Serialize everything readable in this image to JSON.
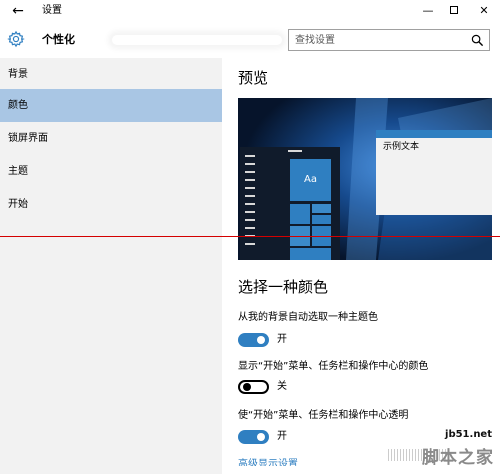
{
  "window": {
    "title": "设置",
    "back_icon": "back-arrow-icon",
    "minimize_glyph": "—",
    "close_glyph": "✕"
  },
  "header": {
    "title": "个性化",
    "icon": "gear-icon"
  },
  "search": {
    "placeholder": "查找设置",
    "icon": "search-icon"
  },
  "sidebar": {
    "items": [
      {
        "label": "背景"
      },
      {
        "label": "颜色",
        "selected": true
      },
      {
        "label": "锁屏界面"
      },
      {
        "label": "主题"
      },
      {
        "label": "开始"
      }
    ]
  },
  "main": {
    "preview_heading": "预览",
    "preview": {
      "tile_label": "Aa",
      "sample_text": "示例文本"
    },
    "section_heading": "选择一种颜色",
    "options": [
      {
        "label": "从我的背景自动选取一种主题色",
        "state_label": "开",
        "on": true
      },
      {
        "label": "显示“开始”菜单、任务栏和操作中心的颜色",
        "state_label": "关",
        "on": false
      },
      {
        "label": "使“开始”菜单、任务栏和操作中心透明",
        "state_label": "开",
        "on": true
      }
    ],
    "link_partial": "高级显示设置"
  },
  "watermark": {
    "url": "jb51.net",
    "text": "脚本之家"
  },
  "colors": {
    "accent": "#2f7fc1",
    "sidebar_bg": "#f2f2f2",
    "selected_bg": "#a9c6e4",
    "desktop_bg": "#0a1d3a"
  }
}
